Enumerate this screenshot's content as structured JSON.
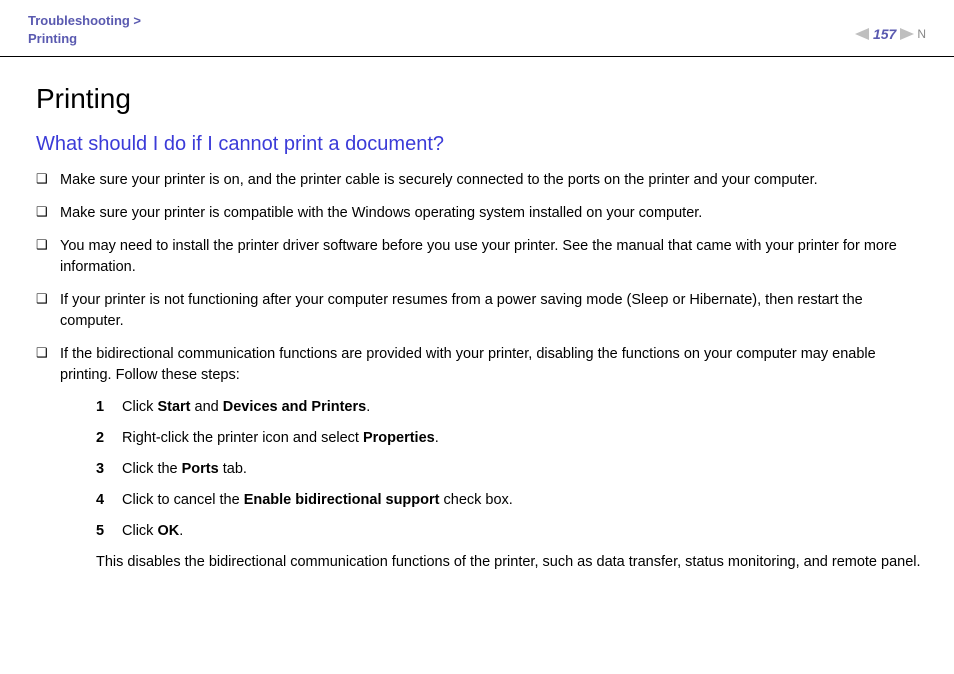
{
  "header": {
    "breadcrumb_top": "Troubleshooting >",
    "breadcrumb_sub": "Printing",
    "page_number": "157"
  },
  "page": {
    "title": "Printing",
    "section_title": "What should I do if I cannot print a document?"
  },
  "bullets": [
    {
      "text": "Make sure your printer is on, and the printer cable is securely connected to the ports on the printer and your computer."
    },
    {
      "text": "Make sure your printer is compatible with the Windows operating system installed on your computer."
    },
    {
      "text": "You may need to install the printer driver software before you use your printer. See the manual that came with your printer for more information."
    },
    {
      "text": "If your printer is not functioning after your computer resumes from a power saving mode (Sleep or Hibernate), then restart the computer."
    },
    {
      "text": "If the bidirectional communication functions are provided with your printer, disabling the functions on your computer may enable printing. Follow these steps:"
    }
  ],
  "steps": [
    {
      "no": "1",
      "pre": "Click ",
      "b1": "Start",
      "mid": " and ",
      "b2": "Devices and Printers",
      "post": "."
    },
    {
      "no": "2",
      "pre": "Right-click the printer icon and select ",
      "b1": "Properties",
      "mid": "",
      "b2": "",
      "post": "."
    },
    {
      "no": "3",
      "pre": "Click the ",
      "b1": "Ports",
      "mid": "",
      "b2": "",
      "post": " tab."
    },
    {
      "no": "4",
      "pre": "Click to cancel the ",
      "b1": "Enable bidirectional support",
      "mid": "",
      "b2": "",
      "post": " check box."
    },
    {
      "no": "5",
      "pre": "Click ",
      "b1": "OK",
      "mid": "",
      "b2": "",
      "post": "."
    }
  ],
  "trailing_note": "This disables the bidirectional communication functions of the printer, such as data transfer, status monitoring, and remote panel."
}
